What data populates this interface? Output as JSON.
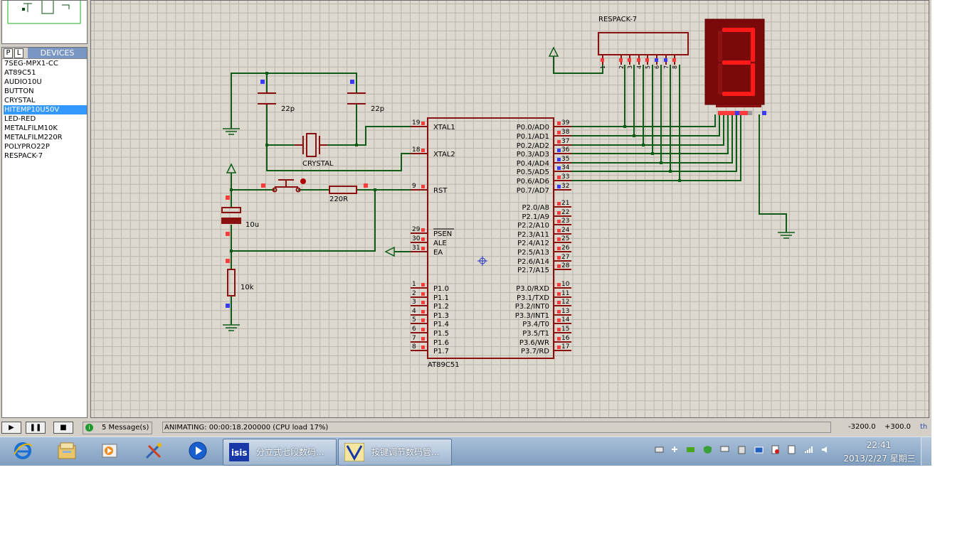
{
  "devices_panel": {
    "tab_p": "P",
    "tab_l": "L",
    "title": "DEVICES",
    "items": [
      "7SEG-MPX1-CC",
      "AT89C51",
      "AUDIO10U",
      "BUTTON",
      "CRYSTAL",
      "HITEMP10U50V",
      "LED-RED",
      "METALFILM10K",
      "METALFILM220R",
      "POLYPRO22P",
      "RESPACK-7"
    ],
    "selected": "HITEMP10U50V"
  },
  "schematic": {
    "mcu": {
      "name": "AT89C51",
      "left_pins": [
        {
          "num": "19",
          "label": "XTAL1"
        },
        {
          "num": "18",
          "label": "XTAL2"
        },
        {
          "num": "9",
          "label": "RST"
        },
        {
          "num": "29",
          "label": "PSEN"
        },
        {
          "num": "30",
          "label": "ALE"
        },
        {
          "num": "31",
          "label": "EA"
        },
        {
          "num": "1",
          "label": "P1.0"
        },
        {
          "num": "2",
          "label": "P1.1"
        },
        {
          "num": "3",
          "label": "P1.2"
        },
        {
          "num": "4",
          "label": "P1.3"
        },
        {
          "num": "5",
          "label": "P1.4"
        },
        {
          "num": "6",
          "label": "P1.5"
        },
        {
          "num": "7",
          "label": "P1.6"
        },
        {
          "num": "8",
          "label": "P1.7"
        }
      ],
      "right_pins": [
        {
          "num": "39",
          "label": "P0.0/AD0"
        },
        {
          "num": "38",
          "label": "P0.1/AD1"
        },
        {
          "num": "37",
          "label": "P0.2/AD2"
        },
        {
          "num": "36",
          "label": "P0.3/AD3"
        },
        {
          "num": "35",
          "label": "P0.4/AD4"
        },
        {
          "num": "34",
          "label": "P0.5/AD5"
        },
        {
          "num": "33",
          "label": "P0.6/AD6"
        },
        {
          "num": "32",
          "label": "P0.7/AD7"
        },
        {
          "num": "21",
          "label": "P2.0/A8"
        },
        {
          "num": "22",
          "label": "P2.1/A9"
        },
        {
          "num": "23",
          "label": "P2.2/A10"
        },
        {
          "num": "24",
          "label": "P2.3/A11"
        },
        {
          "num": "25",
          "label": "P2.4/A12"
        },
        {
          "num": "26",
          "label": "P2.5/A13"
        },
        {
          "num": "27",
          "label": "P2.6/A14"
        },
        {
          "num": "28",
          "label": "P2.7/A15"
        },
        {
          "num": "10",
          "label": "P3.0/RXD"
        },
        {
          "num": "11",
          "label": "P3.1/TXD"
        },
        {
          "num": "12",
          "label": "P3.2/INT0"
        },
        {
          "num": "13",
          "label": "P3.3/INT1"
        },
        {
          "num": "14",
          "label": "P3.4/T0"
        },
        {
          "num": "15",
          "label": "P3.5/T1"
        },
        {
          "num": "16",
          "label": "P3.6/WR"
        },
        {
          "num": "17",
          "label": "P3.7/RD"
        }
      ]
    },
    "respack": {
      "name": "RESPACK-7",
      "pins": [
        "1",
        "2",
        "3",
        "4",
        "5",
        "6",
        "7",
        "8"
      ]
    },
    "seven_segment": {
      "digit": "3",
      "color": "#ff1a1a"
    },
    "cap1_label": "22p",
    "cap2_label": "22p",
    "crystal_label": "CRYSTAL",
    "resistor_label": "220R",
    "elcap_label": "10u",
    "resistor2_label": "10k"
  },
  "status": {
    "messages": "5 Message(s)",
    "animation": "ANIMATING: 00:00:18.200000 (CPU load 17%)",
    "coord_x": "-3200.0",
    "coord_y": "+300.0",
    "unit": "th"
  },
  "sim_controls": {
    "play": "▶",
    "pause": "❚❚",
    "stop": "■"
  },
  "taskbar": {
    "tasks": [
      {
        "label": "分立式七段数码..."
      },
      {
        "label": "按键调节数码管..."
      }
    ],
    "time": "22:41",
    "date": "2013/2/27 星期三"
  },
  "colors": {
    "wire": "#0f5c19",
    "component": "#8b1010",
    "pin_red": "#ff3b3b",
    "pin_blue": "#3b3bff",
    "canvas": "#ddd9cf",
    "led_on": "#ff1a1a"
  }
}
